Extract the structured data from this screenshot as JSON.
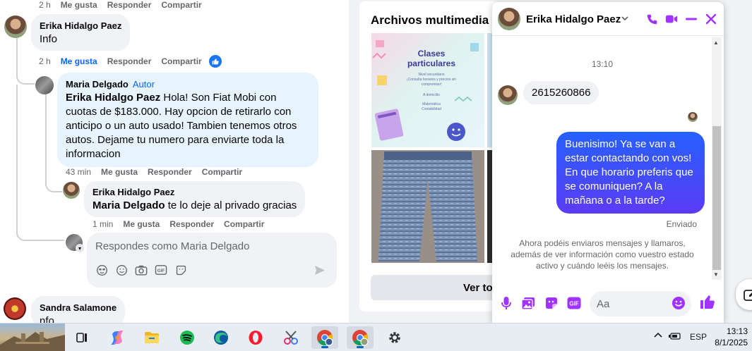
{
  "comments": {
    "top_meta": {
      "time": "2 h",
      "like": "Me gusta",
      "reply": "Responder",
      "share": "Compartir"
    },
    "c1": {
      "name": "Erika Hidalgo Paez",
      "text": "Info",
      "meta": {
        "time": "2 h",
        "like": "Me gusta",
        "reply": "Responder",
        "share": "Compartir"
      }
    },
    "c2": {
      "name": "Maria Delgado",
      "badge": "Autor",
      "mention": "Erika Hidalgo Paez",
      "text": " Hola! Son Fiat Mobi con cuotas de $183.000. Hay opcion de retirarlo con anticipo o un auto usado! Tambien tenemos otros autos. Dejame tu numero para enviarte toda la informacion",
      "meta": {
        "time": "43 min",
        "like": "Me gusta",
        "reply": "Responder",
        "share": "Compartir"
      }
    },
    "c3": {
      "name": "Erika Hidalgo Paez",
      "mention": "Maria Delgado",
      "text": " te lo deje al privado gracias",
      "meta": {
        "time": "1 min",
        "like": "Me gusta",
        "reply": "Responder",
        "share": "Compartir"
      }
    },
    "reply_placeholder": "Respondes como Maria Delgado",
    "c4": {
      "name": "Sandra Salamone",
      "text": "nfo"
    }
  },
  "media": {
    "title": "Archivos multimedia re",
    "thumb1_title": "Clases particulares",
    "thumb1_lines": [
      "Nivel secundario",
      "¡Consulta horarios y precios sin compromiso!",
      "A domicilio",
      "Matemática",
      "Contabilidad"
    ],
    "view_button": "Ver to"
  },
  "chat": {
    "contact_name": "Erika Hidalgo Paez",
    "time_label": "13:10",
    "incoming": "2615260866",
    "outgoing": "Buenisimo! Ya se van a estar contactando con vos! En que horario preferis que se comuniquen? A la mañana o a la tarde?",
    "status": "Enviado",
    "notice": "Ahora podéis enviaros mensajes y llamaros, además de ver información como vuestro estado activo y cuándo leéis los mensajes.",
    "input_placeholder": "Aa",
    "accent": "#a033ff"
  },
  "taskbar": {
    "gif_label": "GIF",
    "lang": "ESP",
    "time": "13:13",
    "date": "8/1/2025"
  }
}
